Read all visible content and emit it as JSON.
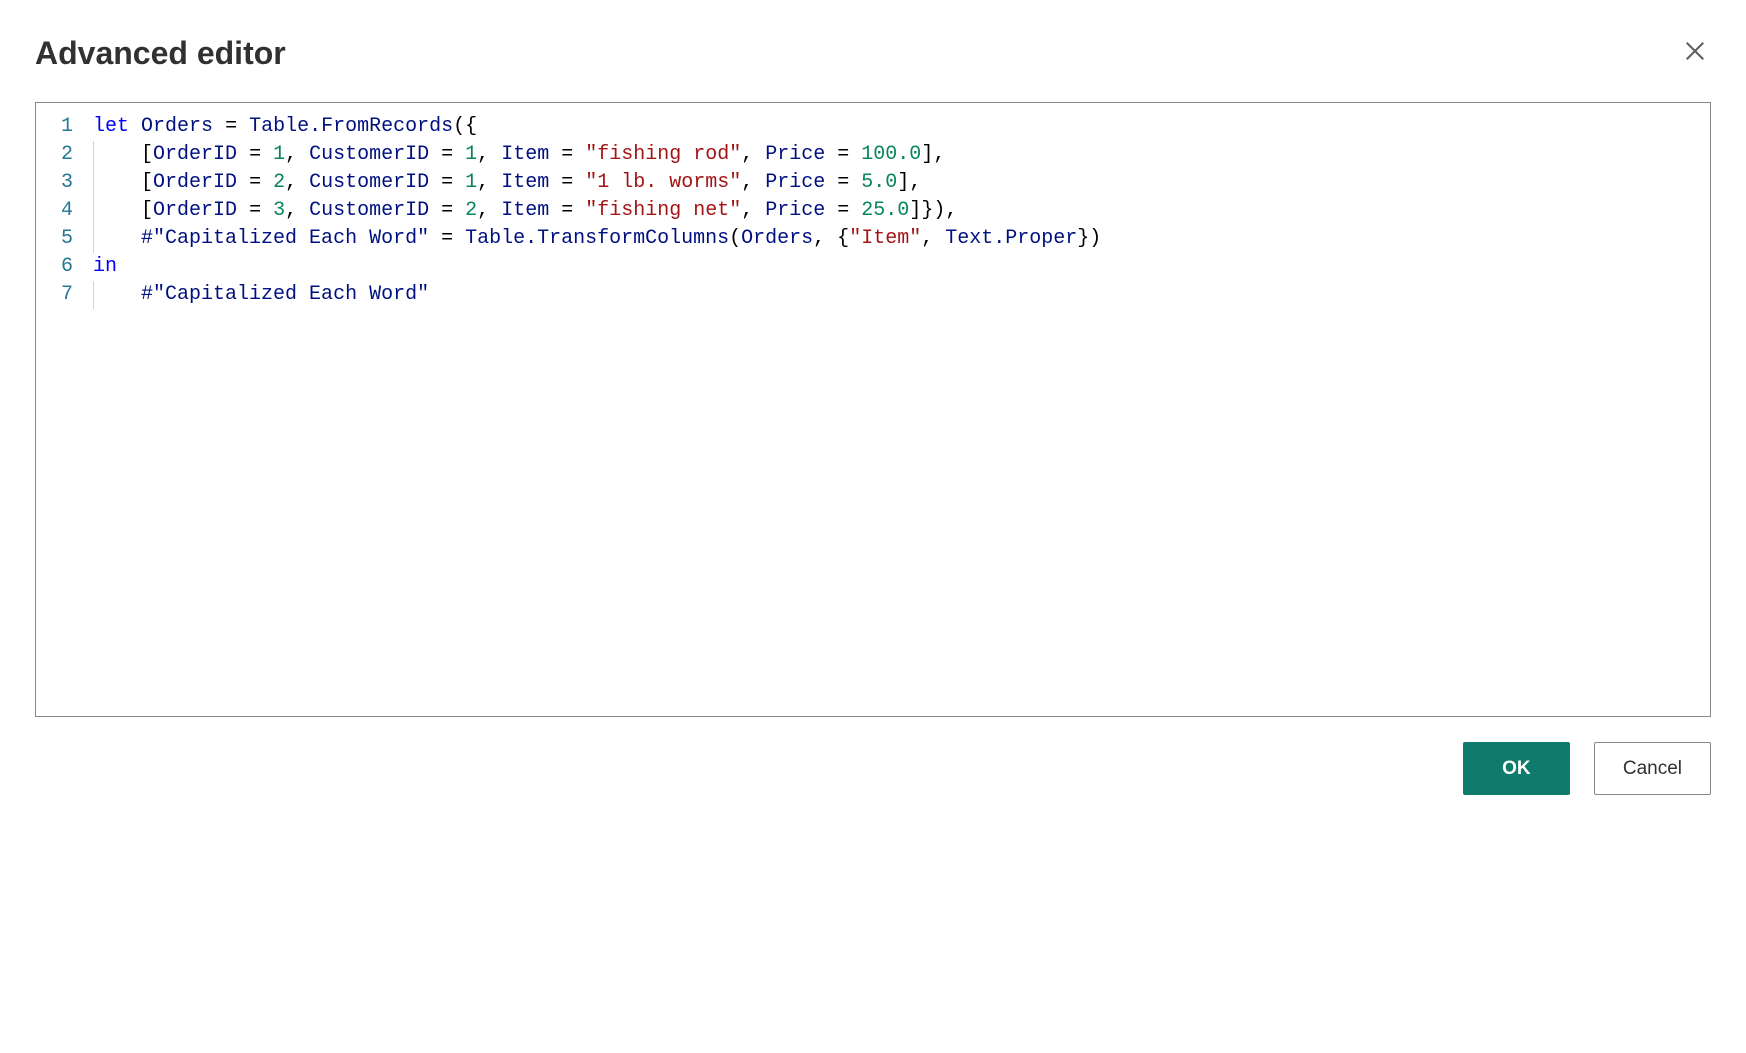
{
  "dialog": {
    "title": "Advanced editor"
  },
  "editor": {
    "lines": [
      {
        "num": "1",
        "indent": 0,
        "tokens": [
          {
            "t": "keyword",
            "v": "let"
          },
          {
            "t": "punct",
            "v": " "
          },
          {
            "t": "ident",
            "v": "Orders"
          },
          {
            "t": "punct",
            "v": " = "
          },
          {
            "t": "ident",
            "v": "Table.FromRecords"
          },
          {
            "t": "punct",
            "v": "({"
          }
        ]
      },
      {
        "num": "2",
        "indent": 1,
        "tokens": [
          {
            "t": "punct",
            "v": "["
          },
          {
            "t": "ident",
            "v": "OrderID"
          },
          {
            "t": "punct",
            "v": " = "
          },
          {
            "t": "num",
            "v": "1"
          },
          {
            "t": "punct",
            "v": ", "
          },
          {
            "t": "ident",
            "v": "CustomerID"
          },
          {
            "t": "punct",
            "v": " = "
          },
          {
            "t": "num",
            "v": "1"
          },
          {
            "t": "punct",
            "v": ", "
          },
          {
            "t": "ident",
            "v": "Item"
          },
          {
            "t": "punct",
            "v": " = "
          },
          {
            "t": "str",
            "v": "\"fishing rod\""
          },
          {
            "t": "punct",
            "v": ", "
          },
          {
            "t": "ident",
            "v": "Price"
          },
          {
            "t": "punct",
            "v": " = "
          },
          {
            "t": "num",
            "v": "100.0"
          },
          {
            "t": "punct",
            "v": "],"
          }
        ]
      },
      {
        "num": "3",
        "indent": 1,
        "tokens": [
          {
            "t": "punct",
            "v": "["
          },
          {
            "t": "ident",
            "v": "OrderID"
          },
          {
            "t": "punct",
            "v": " = "
          },
          {
            "t": "num",
            "v": "2"
          },
          {
            "t": "punct",
            "v": ", "
          },
          {
            "t": "ident",
            "v": "CustomerID"
          },
          {
            "t": "punct",
            "v": " = "
          },
          {
            "t": "num",
            "v": "1"
          },
          {
            "t": "punct",
            "v": ", "
          },
          {
            "t": "ident",
            "v": "Item"
          },
          {
            "t": "punct",
            "v": " = "
          },
          {
            "t": "str",
            "v": "\"1 lb. worms\""
          },
          {
            "t": "punct",
            "v": ", "
          },
          {
            "t": "ident",
            "v": "Price"
          },
          {
            "t": "punct",
            "v": " = "
          },
          {
            "t": "num",
            "v": "5.0"
          },
          {
            "t": "punct",
            "v": "],"
          }
        ]
      },
      {
        "num": "4",
        "indent": 1,
        "tokens": [
          {
            "t": "punct",
            "v": "["
          },
          {
            "t": "ident",
            "v": "OrderID"
          },
          {
            "t": "punct",
            "v": " = "
          },
          {
            "t": "num",
            "v": "3"
          },
          {
            "t": "punct",
            "v": ", "
          },
          {
            "t": "ident",
            "v": "CustomerID"
          },
          {
            "t": "punct",
            "v": " = "
          },
          {
            "t": "num",
            "v": "2"
          },
          {
            "t": "punct",
            "v": ", "
          },
          {
            "t": "ident",
            "v": "Item"
          },
          {
            "t": "punct",
            "v": " = "
          },
          {
            "t": "str",
            "v": "\"fishing net\""
          },
          {
            "t": "punct",
            "v": ", "
          },
          {
            "t": "ident",
            "v": "Price"
          },
          {
            "t": "punct",
            "v": " = "
          },
          {
            "t": "num",
            "v": "25.0"
          },
          {
            "t": "punct",
            "v": "]}),"
          }
        ]
      },
      {
        "num": "5",
        "indent": 1,
        "tokens": [
          {
            "t": "quoted-ident",
            "v": "#\"Capitalized Each Word\""
          },
          {
            "t": "punct",
            "v": " = "
          },
          {
            "t": "ident",
            "v": "Table.TransformColumns"
          },
          {
            "t": "punct",
            "v": "("
          },
          {
            "t": "ident",
            "v": "Orders"
          },
          {
            "t": "punct",
            "v": ", {"
          },
          {
            "t": "str",
            "v": "\"Item\""
          },
          {
            "t": "punct",
            "v": ", "
          },
          {
            "t": "ident",
            "v": "Text.Proper"
          },
          {
            "t": "punct",
            "v": "})"
          }
        ]
      },
      {
        "num": "6",
        "indent": 0,
        "tokens": [
          {
            "t": "keyword",
            "v": "in"
          }
        ]
      },
      {
        "num": "7",
        "indent": 1,
        "tokens": [
          {
            "t": "quoted-ident",
            "v": "#\"Capitalized Each Word\""
          }
        ]
      }
    ]
  },
  "buttons": {
    "ok": "OK",
    "cancel": "Cancel"
  }
}
